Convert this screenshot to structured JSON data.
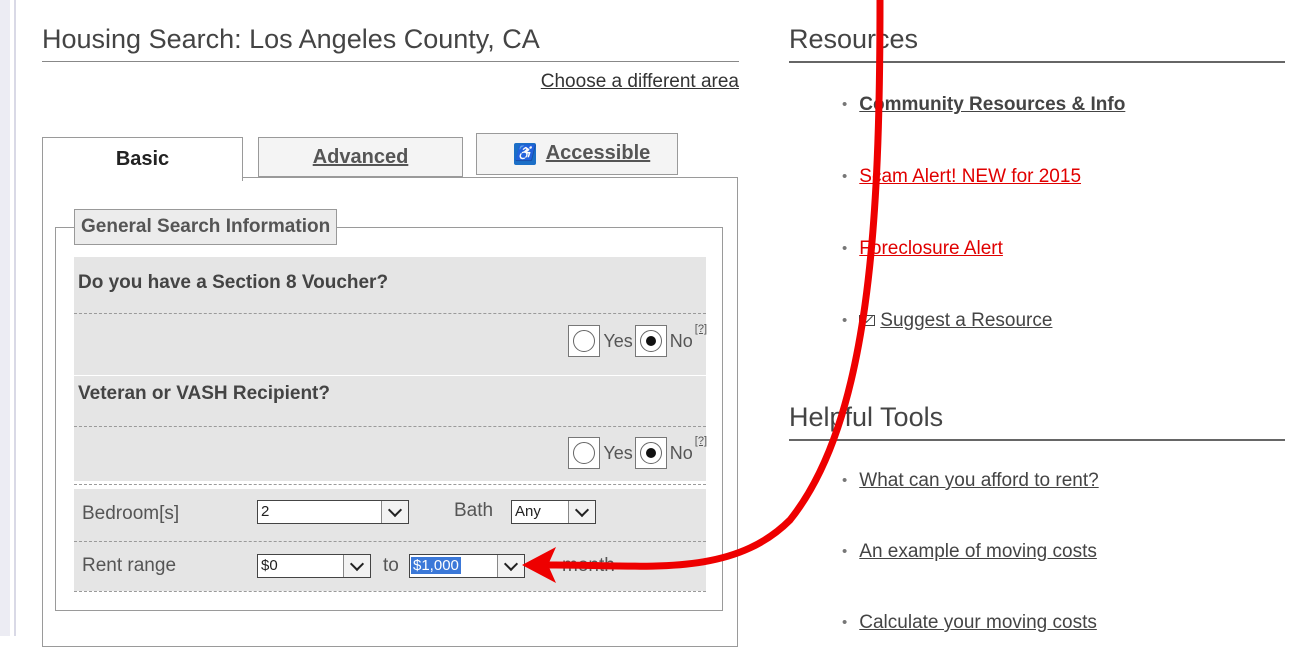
{
  "search": {
    "title": "Housing Search: Los Angeles County, CA",
    "change_area": "Choose a different area",
    "tabs": [
      {
        "label": "Basic",
        "active": true
      },
      {
        "label": "Advanced",
        "active": false
      },
      {
        "label": "Accessible",
        "active": false,
        "icon": "wheelchair-icon"
      }
    ],
    "legend": "General Search Information",
    "section8": {
      "question": "Do you have a Section 8 Voucher?",
      "yes": "Yes",
      "no": "No",
      "selected": "No",
      "help": "[?]"
    },
    "veteran": {
      "question": "Veteran or VASH Recipient?",
      "yes": "Yes",
      "no": "No",
      "selected": "No",
      "help": "[?]"
    },
    "bedrooms": {
      "label": "Bedroom[s]",
      "value": "2"
    },
    "bath": {
      "label": "Bath",
      "value": "Any"
    },
    "rent": {
      "label": "Rent range",
      "min": "$0",
      "to": "to",
      "max": "$1,000",
      "suffix": "month"
    }
  },
  "resources": {
    "title": "Resources",
    "items": [
      {
        "label": "Community Resources & Info"
      },
      {
        "label": "Scam Alert! NEW for 2015"
      },
      {
        "label": "Foreclosure Alert"
      },
      {
        "label": "Suggest a Resource",
        "icon": "mail-icon"
      }
    ]
  },
  "tools": {
    "title": "Helpful Tools",
    "items": [
      {
        "label": "What can you afford to rent?"
      },
      {
        "label": "An example of moving costs"
      },
      {
        "label": "Calculate your moving costs"
      }
    ]
  },
  "colors": {
    "annotation_arrow": "#ee0000",
    "highlight": "#3b78d8",
    "link_red": "#e00000"
  }
}
